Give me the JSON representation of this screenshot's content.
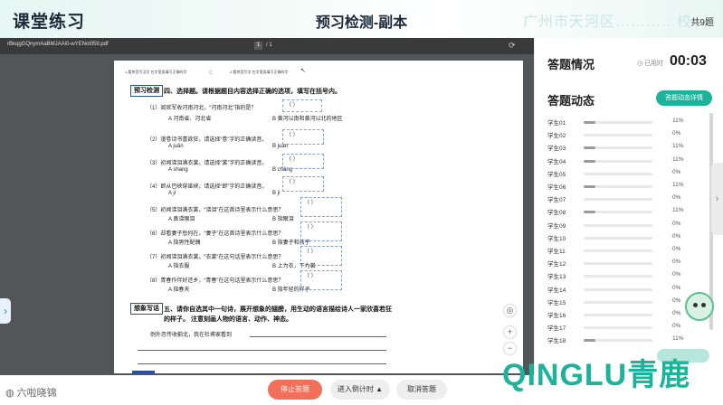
{
  "header": {
    "app_title": "课堂练习",
    "page_title": "预习检测-副本",
    "school_watermark": "广州市天河区…………校",
    "page_count": "共9题"
  },
  "pdf": {
    "filename": "rBkqgGQnymAaBMJAAi0-wYENol059.pdf",
    "page_current": "1",
    "page_total": "/ 1",
    "top_line_left": "1.看拼音写汉字 在字里面填写正确的字",
    "top_line_right": "2.看拼音写字 在字里面填写正确的字",
    "section1_tag": "预习检测",
    "section1_title": "四、选择题。请根据题目内容选择正确的选项，填写在括号内。",
    "questions": [
      {
        "text": "（1）阅官军收河南河北，“河南河北”指的是？",
        "a": "A  河南省、河北省",
        "b": "B  黄河以南和黄河以北的地区",
        "answer": "（        ）"
      },
      {
        "text": "（2）漫卷诗书喜欲狂，请选择“卷”字的正确读音。",
        "a": "A  juǎn",
        "b": "B  juàn",
        "answer": "（        ）"
      },
      {
        "text": "（3）初闻涕泪满衣裳，请选择“裳”字的正确读音。",
        "a": "A  shang",
        "b": "B  cháng",
        "answer": "（        ）"
      },
      {
        "text": "（4）即从巴峡穿巫峡，请选择“即”字的正确读音。",
        "a": "A  jí",
        "b": "B  jì",
        "answer": "（        ）"
      },
      {
        "text": "（5）初闻涕泪满衣裳，“涕泪”在这首诗里表示什么意思？",
        "a": "A  鼻涕眼泪",
        "b": "B  指眼泪",
        "answer": "（        ）"
      },
      {
        "text": "（6）却看妻子愁何在，“妻子”在这首诗里表示什么意思？",
        "a": "A  指男性配偶",
        "b": "B  指妻子和孩子",
        "answer": "（        ）"
      },
      {
        "text": "（7）初闻涕泪满衣裳，“衣裳”在这句话里表示什么意思？",
        "a": "A  指衣服",
        "b": "B 上为衣，下为裳",
        "answer": "（        ）"
      },
      {
        "text": "（8）青春作伴好还乡，“青春”在这句话里表示什么意思？",
        "a": "A  指春天",
        "b": "B  指年轻的样子",
        "answer": "（        ）"
      }
    ],
    "section2_tag": "想象写话",
    "section2_title_1": "五、请你自选其中一句诗，展开想象的翅膀，用生动的语言描绘诗人一家欣喜若狂",
    "section2_title_2": "的样子。 注意刻画人物的语言、动作、神态。",
    "essay_start": "例外忽传收蓟北，我在杜甫家看到"
  },
  "panel": {
    "status_title": "答题情况",
    "timer_label": "已用时",
    "timer": "00:03",
    "dynamics_title": "答题动态",
    "detail_button": "答题动态详情",
    "students": [
      {
        "name": "学生01",
        "pct": "11%",
        "fill": 0.11
      },
      {
        "name": "学生02",
        "pct": "0%",
        "fill": 0
      },
      {
        "name": "学生03",
        "pct": "11%",
        "fill": 0.11
      },
      {
        "name": "学生04",
        "pct": "11%",
        "fill": 0.11
      },
      {
        "name": "学生05",
        "pct": "0%",
        "fill": 0
      },
      {
        "name": "学生06",
        "pct": "11%",
        "fill": 0.11
      },
      {
        "name": "学生07",
        "pct": "0%",
        "fill": 0
      },
      {
        "name": "学生08",
        "pct": "11%",
        "fill": 0.11
      },
      {
        "name": "学生09",
        "pct": "0%",
        "fill": 0
      },
      {
        "name": "学生10",
        "pct": "0%",
        "fill": 0
      },
      {
        "name": "学生11",
        "pct": "0%",
        "fill": 0
      },
      {
        "name": "学生12",
        "pct": "0%",
        "fill": 0
      },
      {
        "name": "学生13",
        "pct": "0%",
        "fill": 0
      },
      {
        "name": "学生14",
        "pct": "0%",
        "fill": 0
      },
      {
        "name": "学生15",
        "pct": "0%",
        "fill": 0
      },
      {
        "name": "学生16",
        "pct": "0%",
        "fill": 0
      },
      {
        "name": "学生17",
        "pct": "0%",
        "fill": 0
      },
      {
        "name": "学生18",
        "pct": "11%",
        "fill": 0.11
      }
    ]
  },
  "bottom": {
    "stop_button": "停止答题",
    "countdown_button": "进入倒计时 ▲",
    "cancel_button": "取消答题",
    "left_logo": "六啦晓锦",
    "brand": "QINGLU青鹿"
  },
  "colors": {
    "accent": "#1bb49a",
    "stop": "#f2705a",
    "pdf_bg": "#525659"
  }
}
